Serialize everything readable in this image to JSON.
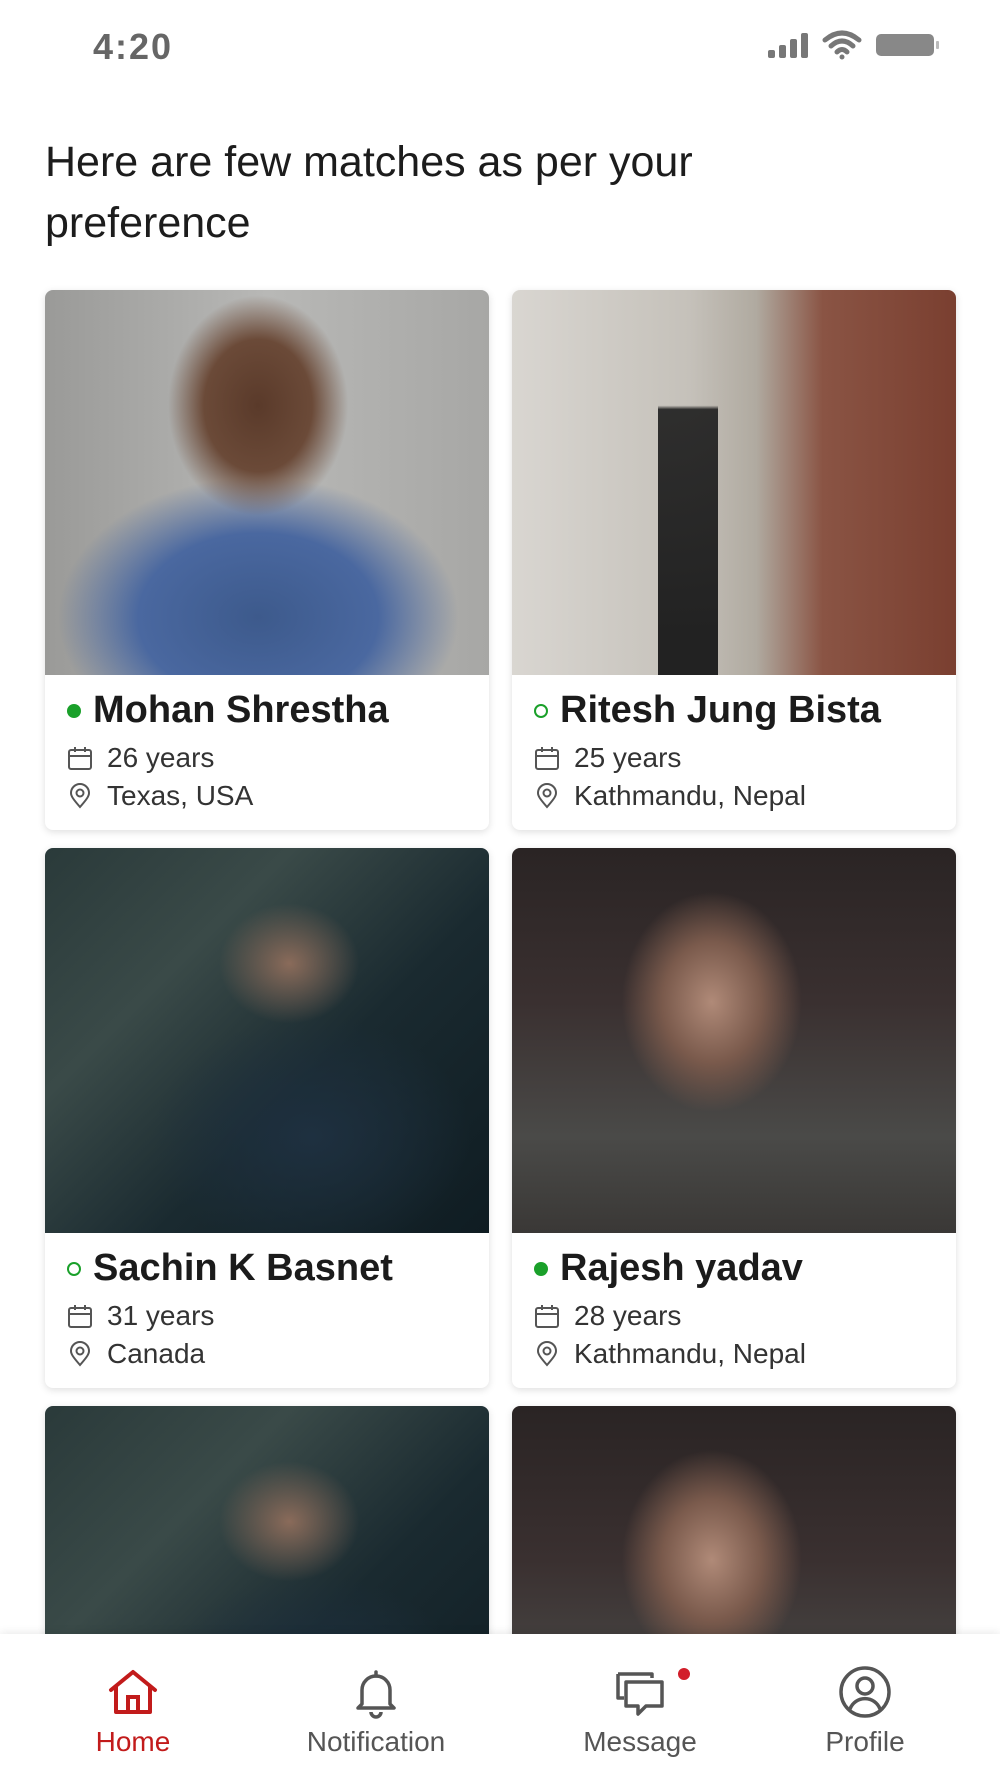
{
  "status_bar": {
    "time": "4:20"
  },
  "headline": "Here are few matches as per your preference",
  "matches": [
    {
      "name": "Mohan Shrestha",
      "age": "26 years",
      "location": "Texas, USA",
      "online": true
    },
    {
      "name": "Ritesh Jung Bista",
      "age": "25 years",
      "location": "Kathmandu, Nepal",
      "online": false
    },
    {
      "name": "Sachin K Basnet",
      "age": "31 years",
      "location": "Canada",
      "online": false
    },
    {
      "name": "Rajesh yadav",
      "age": "28 years",
      "location": "Kathmandu, Nepal",
      "online": true
    }
  ],
  "nav": {
    "home": "Home",
    "notification": "Notification",
    "message": "Message",
    "profile": "Profile"
  },
  "colors": {
    "accent": "#c21b1b",
    "online": "#1aa02a"
  }
}
